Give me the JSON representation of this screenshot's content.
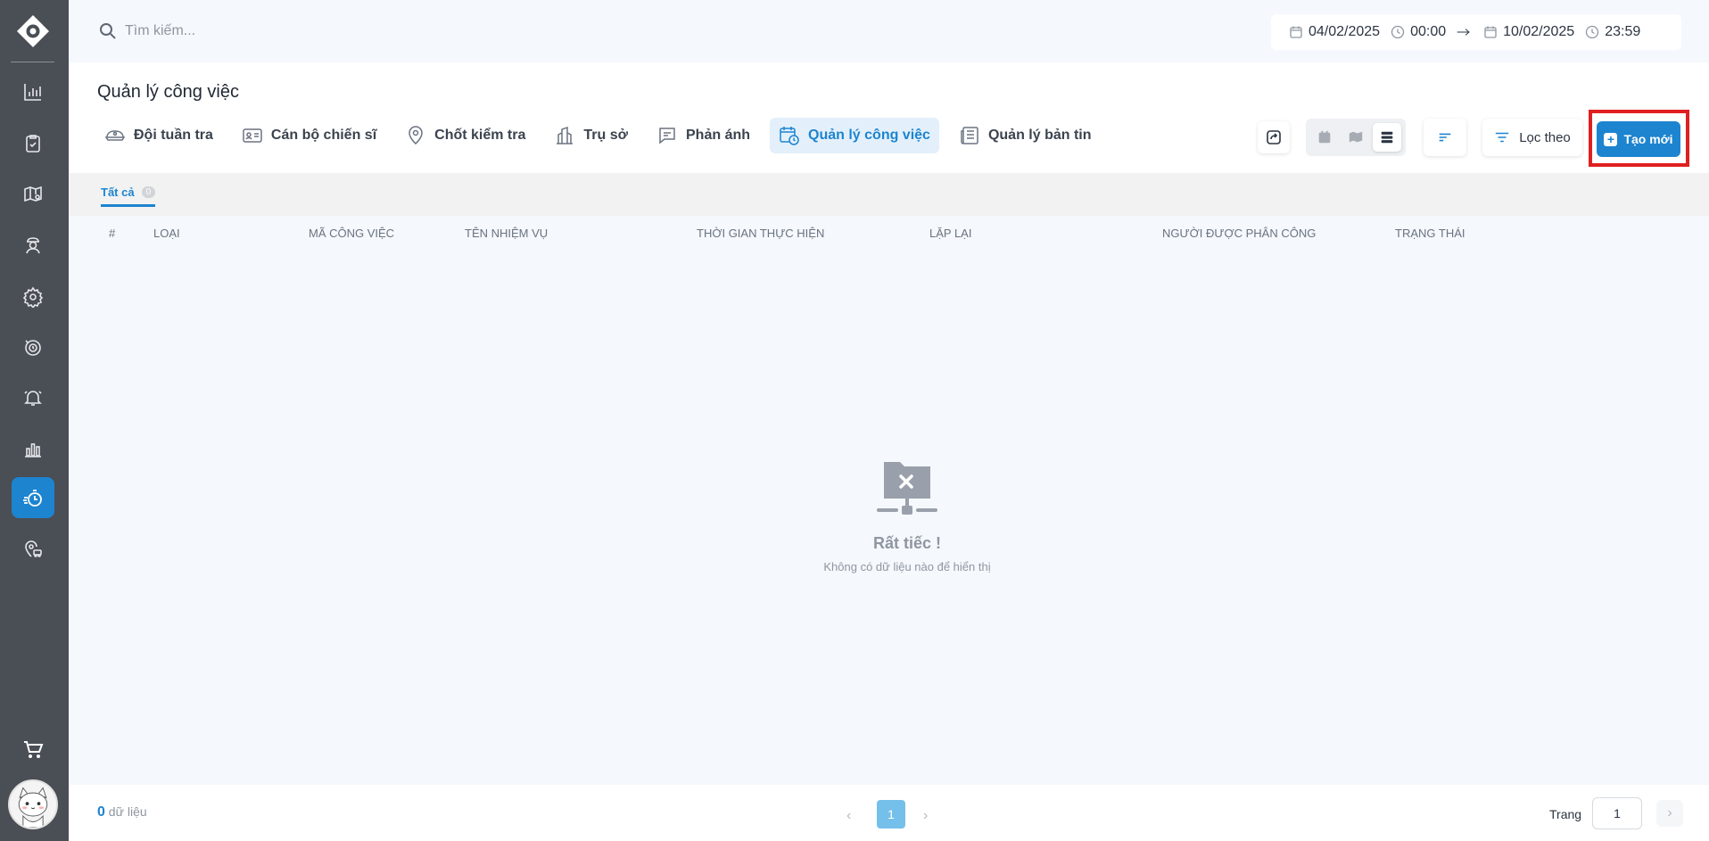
{
  "search": {
    "placeholder": "Tìm kiếm..."
  },
  "date_range": {
    "start_date": "04/02/2025",
    "start_time": "00:00",
    "end_date": "10/02/2025",
    "end_time": "23:59"
  },
  "page": {
    "title": "Quản lý công việc"
  },
  "tabs": [
    {
      "label": "Đội tuần tra",
      "icon": "patrol-cap-icon"
    },
    {
      "label": "Cán bộ chiến sĩ",
      "icon": "id-card-icon"
    },
    {
      "label": "Chốt kiểm tra",
      "icon": "location-pin-icon"
    },
    {
      "label": "Trụ sở",
      "icon": "building-icon"
    },
    {
      "label": "Phản ánh",
      "icon": "chat-bubble-icon"
    },
    {
      "label": "Quản lý công việc",
      "icon": "calendar-clock-icon",
      "active": true
    },
    {
      "label": "Quản lý bản tin",
      "icon": "newspaper-icon"
    }
  ],
  "toolbar": {
    "filter_label": "Lọc theo",
    "create_label": "Tạo mới"
  },
  "status_tabs": [
    {
      "label": "Tất cả",
      "count": "0"
    }
  ],
  "table": {
    "columns": [
      "#",
      "Loại",
      "Mã công việc",
      "Tên nhiệm vụ",
      "Thời gian thực hiện",
      "Lặp lại",
      "Người được phân công",
      "Trạng thái"
    ]
  },
  "empty_state": {
    "title": "Rất tiếc !",
    "message": "Không có dữ liệu nào để hiển thị"
  },
  "footer": {
    "total_count": "0",
    "total_suffix": "dữ liệu",
    "current_page": "1",
    "page_label": "Trang",
    "page_input_value": "1"
  },
  "colors": {
    "sidebar_bg": "#4a4e55",
    "accent": "#1d84cf",
    "highlight": "#e02020"
  }
}
